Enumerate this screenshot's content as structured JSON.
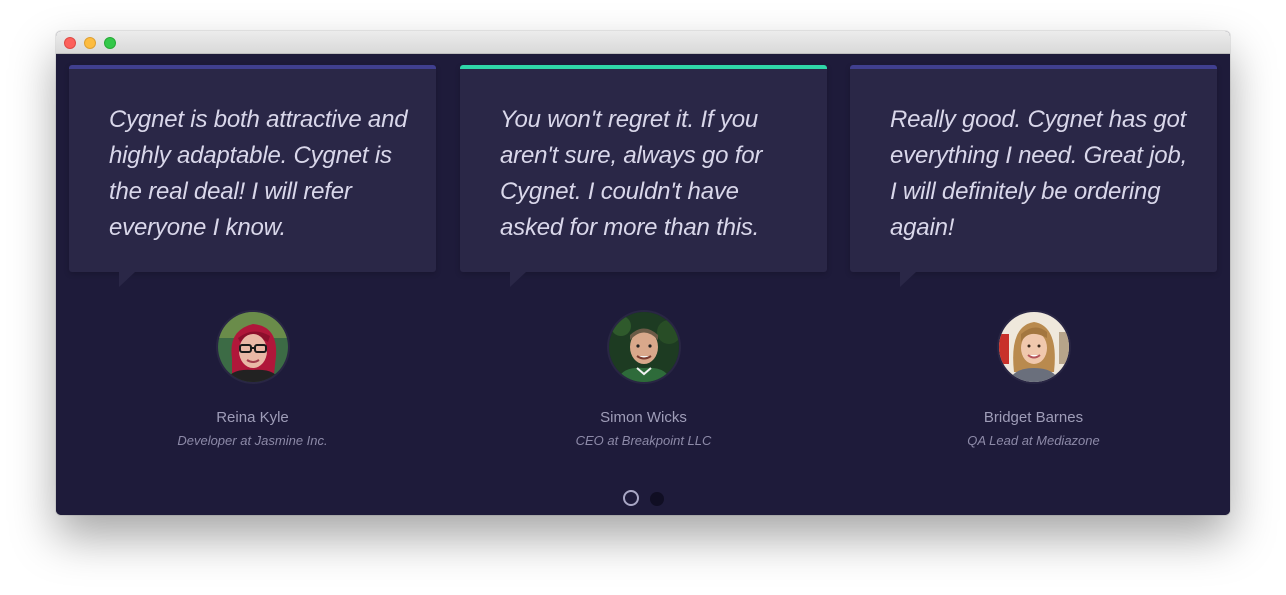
{
  "colors": {
    "background": "#1e1b3a",
    "card": "#2a2747",
    "accent_active": "#2fd6a8",
    "accent_default": "#403f8f",
    "name_text": "#9f9db8"
  },
  "testimonials": [
    {
      "quote": "Cygnet is both attractive and highly adaptable. Cygnet is the real deal! I will refer everyone I know.",
      "name": "Reina Kyle",
      "role": "Developer at Jasmine Inc."
    },
    {
      "quote": "You won't regret it. If you aren't sure, always go for Cygnet. I couldn't have asked for more than this.",
      "name": "Simon Wicks",
      "role": "CEO at Breakpoint LLC"
    },
    {
      "quote": "Really good. Cygnet has got everything I need. Great job, I will definitely be ordering again!",
      "name": "Bridget Barnes",
      "role": "QA Lead at Mediazone"
    }
  ],
  "carousel": {
    "active_index": 1,
    "page_count": 2,
    "current_page": 1
  }
}
